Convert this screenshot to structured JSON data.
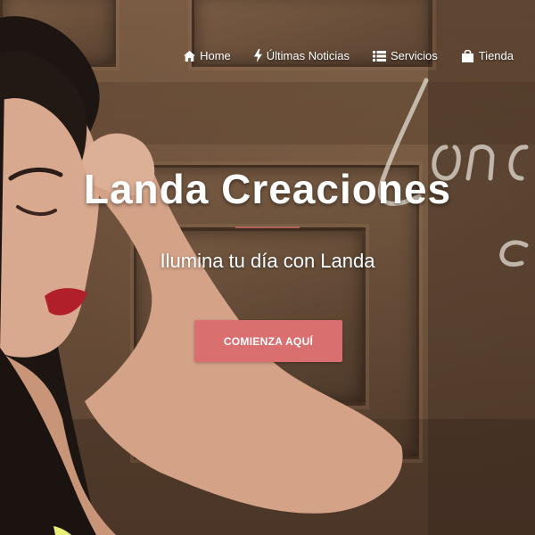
{
  "nav": {
    "items": [
      {
        "label": "Home",
        "icon": "home-icon"
      },
      {
        "label": "Últimas Noticias",
        "icon": "bolt-icon"
      },
      {
        "label": "Servicios",
        "icon": "list-icon"
      },
      {
        "label": "Tienda",
        "icon": "shopping-bag-icon"
      }
    ]
  },
  "hero": {
    "title": "Landa Creaciones",
    "subtitle": "Ilumina tu día con Landa",
    "cta_label": "COMIENZA AQUÍ"
  },
  "colors": {
    "accent": "#d96f6f",
    "text": "#ffffff",
    "wood": "#6b4f3a"
  }
}
